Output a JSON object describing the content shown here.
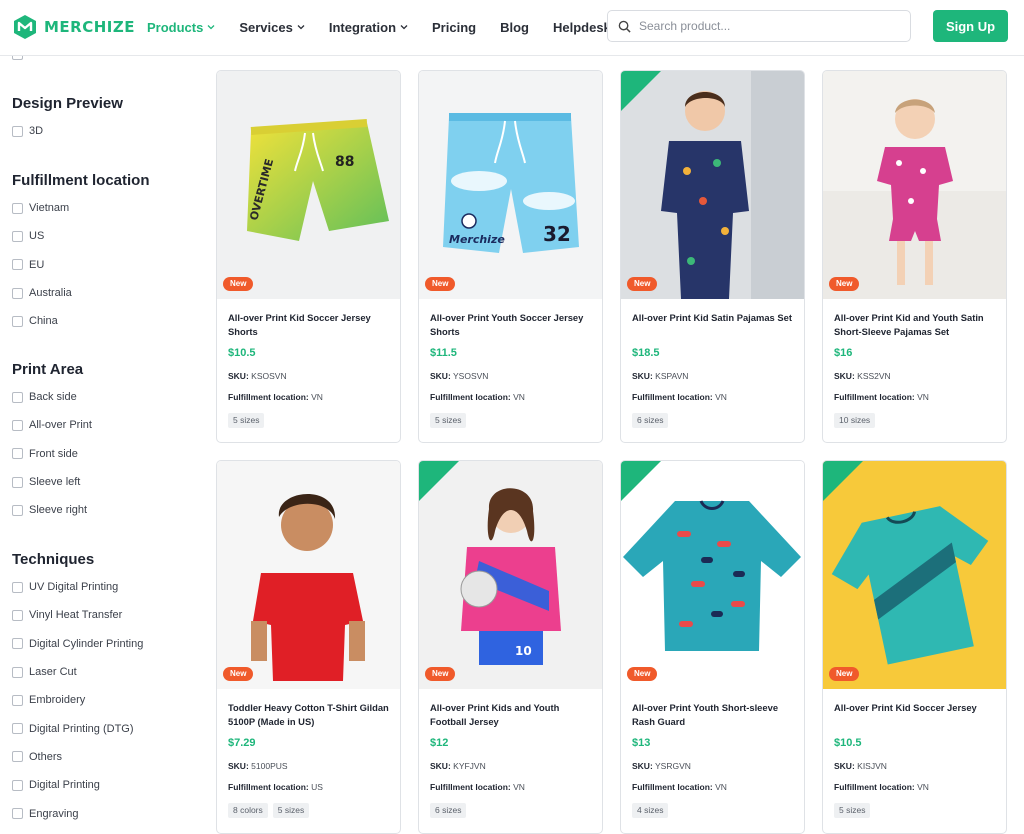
{
  "header": {
    "logo_text": "MERCHIZE",
    "nav": [
      {
        "label": "Products",
        "dropdown": true,
        "active": true
      },
      {
        "label": "Services",
        "dropdown": true,
        "active": false
      },
      {
        "label": "Integration",
        "dropdown": true,
        "active": false
      },
      {
        "label": "Pricing",
        "dropdown": false,
        "active": false
      },
      {
        "label": "Blog",
        "dropdown": false,
        "active": false
      },
      {
        "label": "Helpdesk",
        "dropdown": false,
        "active": false
      }
    ],
    "search_placeholder": "Search product...",
    "signup_label": "Sign Up"
  },
  "colors": {
    "brand": "#1eb67b",
    "new_badge": "#f05a2b",
    "price": "#1eb67b"
  },
  "filters": [
    {
      "title": "Design Preview",
      "options": [
        "3D"
      ]
    },
    {
      "title": "Fulfillment location",
      "options": [
        "Vietnam",
        "US",
        "EU",
        "Australia",
        "China"
      ]
    },
    {
      "title": "Print Area",
      "options": [
        "Back side",
        "All-over Print",
        "Front side",
        "Sleeve left",
        "Sleeve right"
      ]
    },
    {
      "title": "Techniques",
      "options": [
        "UV Digital Printing",
        "Vinyl Heat Transfer",
        "Digital Cylinder Printing",
        "Laser Cut",
        "Embroidery",
        "Digital Printing (DTG)",
        "Others",
        "Digital Printing",
        "Engraving"
      ]
    }
  ],
  "labels": {
    "sku": "SKU:",
    "fulfillment": "Fulfillment location:",
    "new_badge": "New"
  },
  "products": [
    {
      "name": "All-over Print Kid Soccer Jersey Shorts",
      "price": "$10.5",
      "sku": "KSOSVN",
      "location": "VN",
      "chips": [
        "5 sizes"
      ]
    },
    {
      "name": "All-over Print Youth Soccer Jersey Shorts",
      "price": "$11.5",
      "sku": "YSOSVN",
      "location": "VN",
      "chips": [
        "5 sizes"
      ]
    },
    {
      "name": "All-over Print Kid Satin Pajamas Set",
      "price": "$18.5",
      "sku": "KSPAVN",
      "location": "VN",
      "chips": [
        "6 sizes"
      ]
    },
    {
      "name": "All-over Print Kid and Youth Satin Short-Sleeve Pajamas Set",
      "price": "$16",
      "sku": "KSS2VN",
      "location": "VN",
      "chips": [
        "10 sizes"
      ]
    },
    {
      "name": "Toddler Heavy Cotton T-Shirt Gildan 5100P (Made in US)",
      "price": "$7.29",
      "sku": "5100PUS",
      "location": "US",
      "chips": [
        "8 colors",
        "5 sizes"
      ]
    },
    {
      "name": "All-over Print Kids and Youth Football Jersey",
      "price": "$12",
      "sku": "KYFJVN",
      "location": "VN",
      "chips": [
        "6 sizes"
      ]
    },
    {
      "name": "All-over Print Youth Short-sleeve Rash Guard",
      "price": "$13",
      "sku": "YSRGVN",
      "location": "VN",
      "chips": [
        "4 sizes"
      ]
    },
    {
      "name": "All-over Print Kid Soccer Jersey",
      "price": "$10.5",
      "sku": "KISJVN",
      "location": "VN",
      "chips": [
        "5 sizes"
      ]
    }
  ]
}
